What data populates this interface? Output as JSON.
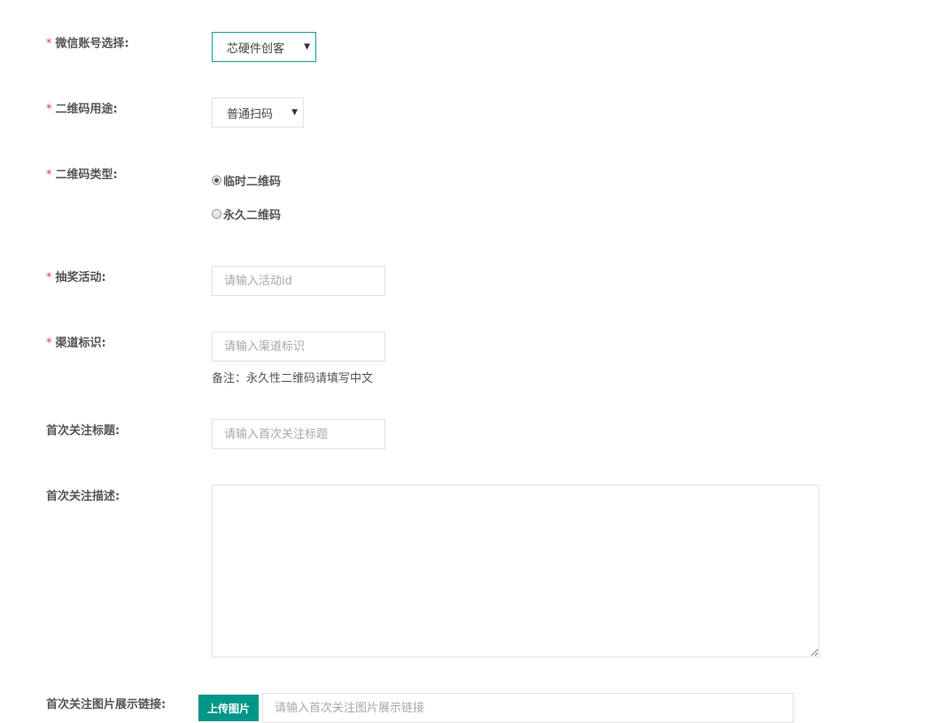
{
  "required_mark": "*",
  "wechat_account": {
    "label": "微信账号选择:",
    "value": "芯硬件创客",
    "caret": "▼"
  },
  "qr_usage": {
    "label": "二维码用途:",
    "value": "普通扫码",
    "caret": "▼"
  },
  "qr_type": {
    "label": "二维码类型:",
    "options": [
      {
        "label": "临时二维码",
        "checked": true
      },
      {
        "label": "永久二维码",
        "checked": false
      }
    ]
  },
  "lottery": {
    "label": "抽奖活动:",
    "placeholder": "请输入活动id"
  },
  "channel": {
    "label": "渠道标识:",
    "placeholder": "请输入渠道标识",
    "note": "备注：永久性二维码请填写中文"
  },
  "first_follow_title": {
    "label": "首次关注标题:",
    "placeholder": "请输入首次关注标题"
  },
  "first_follow_desc": {
    "label": "首次关注描述:"
  },
  "first_follow_image": {
    "label": "首次关注图片展示链接:",
    "upload_label": "上传图片",
    "placeholder": "请输入首次关注图片展示链接"
  },
  "colors": {
    "accent": "#009688",
    "focus_border": "#1aa094",
    "required": "#e04040"
  }
}
